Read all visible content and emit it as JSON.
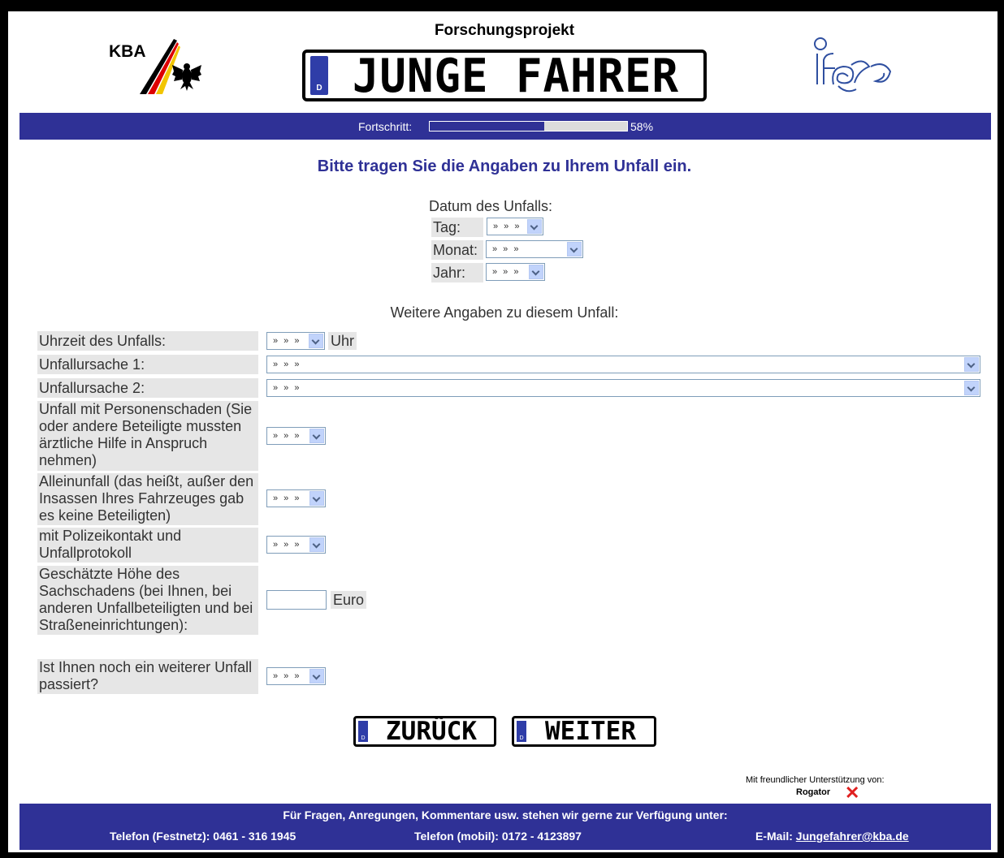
{
  "header": {
    "kba_label": "KBA",
    "project_label": "Forschungsprojekt",
    "plate_text": "JUNGE FAHRER",
    "plate_country": "D"
  },
  "progress": {
    "label": "Fortschritt:",
    "value": 58,
    "percent_text": "58%"
  },
  "main": {
    "heading": "Bitte tragen Sie die Angaben zu Ihrem Unfall ein.",
    "date": {
      "title": "Datum des Unfalls:",
      "day_label": "Tag:",
      "month_label": "Monat:",
      "year_label": "Jahr:",
      "day_value": "» » »",
      "month_value": "» » »",
      "year_value": "» » »"
    },
    "more_title": "Weitere Angaben zu diesem Unfall:",
    "fields": {
      "time_label": "Uhrzeit des Unfalls:",
      "time_value": "» » »",
      "time_unit": "Uhr",
      "cause1_label": "Unfallursache 1:",
      "cause1_value": "» » »",
      "cause2_label": "Unfallursache 2:",
      "cause2_value": "» » »",
      "injury_label": "Unfall mit Personenschaden (Sie oder andere Beteiligte mussten ärztliche Hilfe in Anspruch nehmen)",
      "injury_value": "» » »",
      "single_label": "Alleinunfall (das heißt, außer den Insassen Ihres Fahrzeuges gab es keine Beteiligten)",
      "single_value": "» » »",
      "police_label": "mit Polizeikontakt und Unfallprotokoll",
      "police_value": "» » »",
      "damage_label": "Geschätzte Höhe des Sachschadens (bei Ihnen, bei anderen Unfallbeteiligten und bei Straßeneinrichtungen):",
      "damage_value": "",
      "damage_unit": "Euro",
      "another_label": "Ist Ihnen noch ein weiterer Unfall passiert?",
      "another_value": "» » »"
    }
  },
  "nav": {
    "back_label": "ZURÜCK",
    "next_label": "WEITER",
    "plate_country": "D"
  },
  "sponsor": {
    "text": "Mit freundlicher Unterstützung von:",
    "logo_text": "Rogator"
  },
  "footer": {
    "line1": "Für Fragen, Anregungen, Kommentare usw. stehen wir gerne zur Verfügung unter:",
    "phone_landline": "Telefon (Festnetz): 0461 - 316 1945",
    "phone_mobile": "Telefon (mobil): 0172 - 4123897",
    "email_label": "E-Mail: ",
    "email": "Jungefahrer@kba.de"
  },
  "colors": {
    "brand_blue": "#2f3196",
    "label_bg": "#e6e6e6"
  }
}
